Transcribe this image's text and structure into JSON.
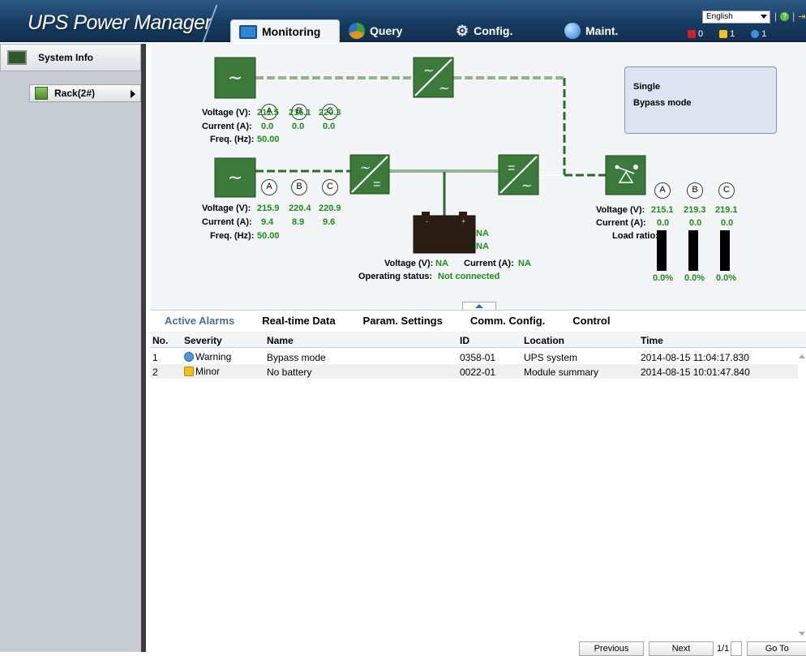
{
  "app": {
    "title": "UPS Power Manager"
  },
  "nav": {
    "tabs": [
      {
        "label": "Monitoring"
      },
      {
        "label": "Query"
      },
      {
        "label": "Config."
      },
      {
        "label": "Maint."
      }
    ]
  },
  "header": {
    "language": "English",
    "alarm_counts": {
      "critical": "0",
      "minor": "1",
      "warning": "1"
    }
  },
  "sidebar": {
    "system_info": "System Info",
    "rack": "Rack(2#)"
  },
  "diagram": {
    "bypass_input": {
      "voltage_label": "Voltage (V):",
      "current_label": "Current (A):",
      "freq_label": "Freq. (Hz):",
      "voltage": [
        "211.5",
        "216.1",
        "220.3"
      ],
      "current": [
        "0.0",
        "0.0",
        "0.0"
      ],
      "freq": "50.00"
    },
    "mains_input": {
      "voltage_label": "Voltage (V):",
      "current_label": "Current (A):",
      "freq_label": "Freq. (Hz):",
      "voltage": [
        "215.9",
        "220.4",
        "220.9"
      ],
      "current": [
        "9.4",
        "8.9",
        "9.6"
      ],
      "freq": "50.00"
    },
    "phases": [
      "A",
      "B",
      "C"
    ],
    "battery": {
      "status_top": "NA",
      "status_bottom": "NA",
      "voltage_label": "Voltage (V):",
      "voltage": "NA",
      "current_label": "Current (A):",
      "current": "NA",
      "status_label": "Operating status:",
      "status": "Not connected"
    },
    "output": {
      "voltage_label": "Voltage (V):",
      "current_label": "Current (A):",
      "load_label": "Load ratio:",
      "voltage": [
        "215.1",
        "219.3",
        "219.1"
      ],
      "current": [
        "0.0",
        "0.0",
        "0.0"
      ],
      "load": [
        "0.0%",
        "0.0%",
        "0.0%"
      ]
    },
    "mode": {
      "line1": "Single",
      "line2": "Bypass mode"
    }
  },
  "lower_tabs": [
    "Active Alarms",
    "Real-time Data",
    "Param. Settings",
    "Comm. Config.",
    "Control"
  ],
  "alarms": {
    "columns": [
      "No.",
      "Severity",
      "Name",
      "ID",
      "Location",
      "Time"
    ],
    "rows": [
      {
        "no": "1",
        "severity": "Warning",
        "name": "Bypass mode",
        "id": "0358-01",
        "location": "UPS system",
        "time": "2014-08-15 11:04:17.830"
      },
      {
        "no": "2",
        "severity": "Minor",
        "name": "No battery",
        "id": "0022-01",
        "location": "Module summary",
        "time": "2014-08-15 10:01:47.840"
      }
    ]
  },
  "pager": {
    "previous": "Previous",
    "next": "Next",
    "page": "1/1",
    "goto": "Go To"
  },
  "colors": {
    "accent_green": "#3b7a3b",
    "value_green": "#1b8f1b",
    "header_blue": "#1f4770"
  }
}
